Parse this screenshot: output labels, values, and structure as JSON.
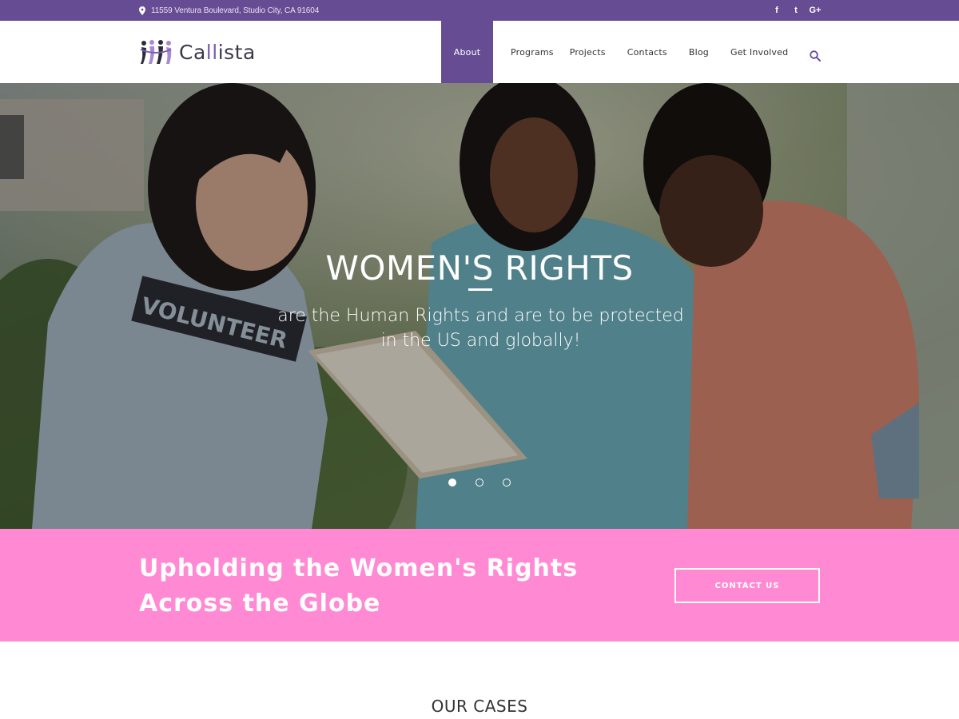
{
  "topbar": {
    "address": "11559 Ventura Boulevard, Studio City, CA 91604",
    "social": [
      {
        "icon": "facebook-icon",
        "glyph": "f"
      },
      {
        "icon": "twitter-icon",
        "glyph": "t"
      },
      {
        "icon": "google-plus-icon",
        "glyph": "G+"
      }
    ]
  },
  "header": {
    "logo_prefix": "Ca",
    "logo_accent": "ll",
    "logo_suffix": "ista",
    "nav": [
      "About",
      "Programs",
      "Projects",
      "Contacts",
      "Blog",
      "Get Involved"
    ],
    "active_nav": "About"
  },
  "hero": {
    "title": "WOMEN'S RIGHTS",
    "subtitle": "are the Human Rights and are to be protected in the US and globally!",
    "slides": 3,
    "active_slide": 1
  },
  "banner": {
    "headline": "Upholding the Women's Rights Across the Globe",
    "button": "CONTACT US"
  },
  "section": {
    "title": "OUR CASES"
  },
  "colors": {
    "primary_purple": "#664c93",
    "banner_pink": "#ff8ad3",
    "white": "#ffffff"
  }
}
